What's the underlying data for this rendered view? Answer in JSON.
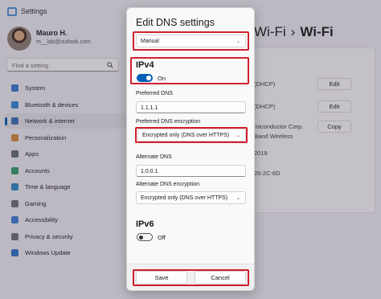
{
  "window": {
    "title": "Settings",
    "user": {
      "name": "Mauro H.",
      "email": "m__lab@outlook.com"
    },
    "search": {
      "placeholder": "Find a setting"
    },
    "nav_items": [
      {
        "label": "System",
        "icon": "monitor-icon",
        "color": "#3a78d4"
      },
      {
        "label": "Bluetooth & devices",
        "icon": "bluetooth-icon",
        "color": "#2f86d8"
      },
      {
        "label": "Network & internet",
        "icon": "network-icon",
        "color": "#3a6fb3",
        "active": true
      },
      {
        "label": "Personalization",
        "icon": "brush-icon",
        "color": "#d68a3a"
      },
      {
        "label": "Apps",
        "icon": "apps-icon",
        "color": "#5f6b78"
      },
      {
        "label": "Accounts",
        "icon": "person-icon",
        "color": "#2f9c6a"
      },
      {
        "label": "Time & language",
        "icon": "globe-clock-icon",
        "color": "#2d8ac7"
      },
      {
        "label": "Gaming",
        "icon": "controller-icon",
        "color": "#6b6f78"
      },
      {
        "label": "Accessibility",
        "icon": "accessibility-icon",
        "color": "#3d7ad6"
      },
      {
        "label": "Privacy & security",
        "icon": "shield-icon",
        "color": "#6b6f78"
      },
      {
        "label": "Windows Update",
        "icon": "update-icon",
        "color": "#2f74cc"
      }
    ],
    "breadcrumb": {
      "parent": "Wi-Fi",
      "current": "Wi-Fi"
    },
    "details": {
      "row1": "(DHCP)",
      "row2": "(DHCP)",
      "row3": [
        "miconductor Corp.",
        "Band Wireless",
        "2019",
        "26-2C-6D"
      ],
      "edit_label": "Edit",
      "copy_label": "Copy"
    }
  },
  "dialog": {
    "title": "Edit DNS settings",
    "mode": "Manual",
    "ipv4": {
      "heading": "IPv4",
      "toggle_label": "On",
      "preferred_label": "Preferred DNS",
      "preferred_value": "1.1.1.1",
      "preferred_enc_label": "Preferred DNS encryption",
      "preferred_enc_value": "Encrypted only (DNS over HTTPS)",
      "alternate_label": "Alternate DNS",
      "alternate_value": "1.0.0.1",
      "alternate_enc_label": "Alternate DNS encryption",
      "alternate_enc_value": "Encrypted only (DNS over HTTPS)"
    },
    "ipv6": {
      "heading": "IPv6",
      "toggle_label": "Off"
    },
    "save_label": "Save",
    "cancel_label": "Cancel"
  },
  "colors": {
    "accent": "#005fb8",
    "highlight": "#d21f2e"
  }
}
